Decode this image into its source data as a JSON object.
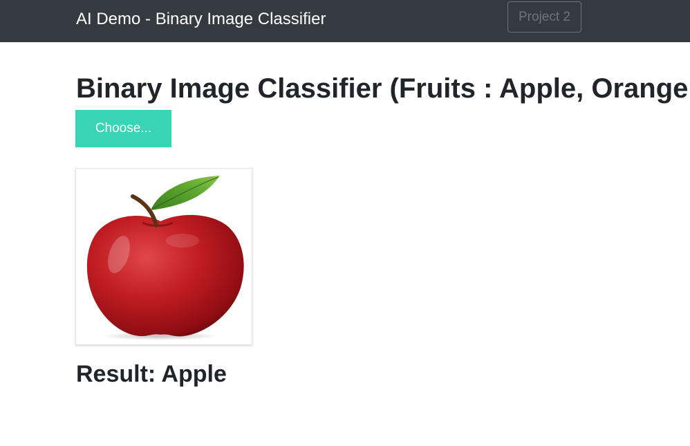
{
  "navbar": {
    "brand": "AI Demo - Binary Image Classifier",
    "project_button": "Project 2"
  },
  "main": {
    "title": "Binary Image Classifier (Fruits : Apple, Orange )",
    "choose_button": "Choose...",
    "result": "Result: Apple"
  },
  "colors": {
    "navbar_bg": "#343a40",
    "choose_button_bg": "#39d3b5",
    "apple_red": "#b3151b",
    "leaf_green": "#4f9a2a"
  }
}
